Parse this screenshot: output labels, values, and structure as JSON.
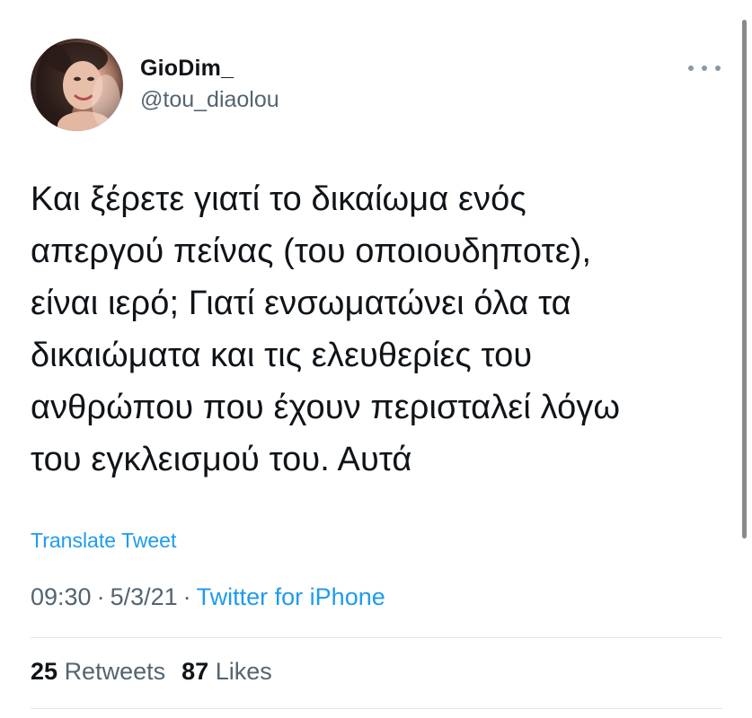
{
  "author": {
    "display_name": "GioDim_",
    "handle": "@tou_diaolou",
    "avatar_icon": "profile-photo"
  },
  "more_menu": {
    "icon": "more-dots-icon"
  },
  "tweet": {
    "lines": [
      "Και ξέρετε γιατί το δικαίωμα ενός",
      "απεργού πείνας (του οποιουδηποτε),",
      "είναι ιερό; Γιατί ενσωματώνει όλα τα",
      "δικαιώματα και τις ελευθερίες του",
      "ανθρώπου που έχουν περισταλεί λόγω",
      "του εγκλεισμού του. Αυτά"
    ],
    "translate_label": "Translate Tweet",
    "time": "09:30",
    "separator": "·",
    "date": "5/3/21",
    "source": "Twitter for iPhone"
  },
  "stats": {
    "retweets_count": "25",
    "retweets_label": "Retweets",
    "likes_count": "87",
    "likes_label": "Likes"
  },
  "colors": {
    "accent": "#1d9bf0",
    "secondary_text": "#536471",
    "primary_text": "#0f1419"
  }
}
